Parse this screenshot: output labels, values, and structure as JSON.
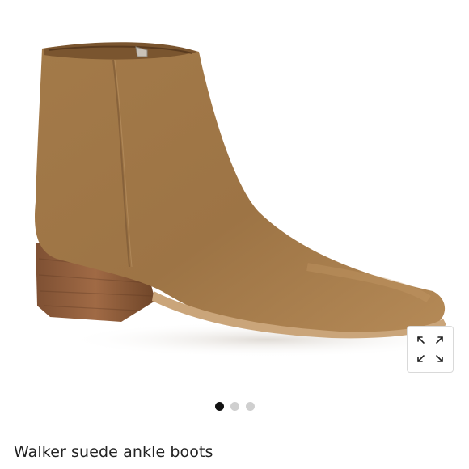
{
  "product": {
    "title": "Walker suede ankle boots",
    "image_icon": "ankle-boot-photo",
    "colors": {
      "suede": "#a57b4a",
      "heel": "#8a5a3a",
      "sole": "#c9a57c"
    }
  },
  "carousel": {
    "total": 3,
    "active_index": 0,
    "active_color": "#111111",
    "inactive_color": "#cfcfcf"
  },
  "expand_button": {
    "icon": "expand-arrows-icon"
  }
}
